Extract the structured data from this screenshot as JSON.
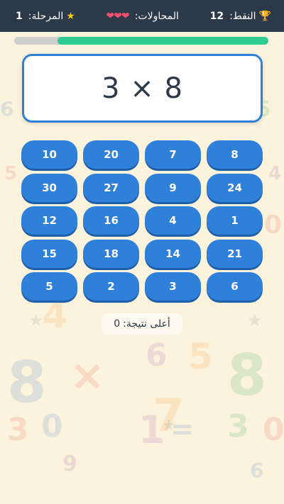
{
  "header": {
    "points_label": "النقط:",
    "points_value": "12",
    "attempts_label": "المحاولات:",
    "attempts_hearts": "❤❤❤",
    "level_label": "المرحلة:",
    "level_value": "1",
    "trophy_icon": "🏆",
    "star_icon": "★"
  },
  "progress": {
    "fraction": 0.83,
    "fill_color": "#2ecc91",
    "track_color": "#cfcfcf"
  },
  "question": {
    "text": "3 × 8"
  },
  "answers": [
    "10",
    "20",
    "7",
    "8",
    "30",
    "27",
    "9",
    "24",
    "12",
    "16",
    "4",
    "1",
    "15",
    "18",
    "14",
    "21",
    "5",
    "2",
    "3",
    "6"
  ],
  "high_score": {
    "label": "أعلى نتيجة:",
    "value": "0"
  },
  "colors": {
    "top_bar": "#2c3948",
    "button": "#2f80d9",
    "card_border": "#2f80d9",
    "background": "#fcf3dc"
  }
}
